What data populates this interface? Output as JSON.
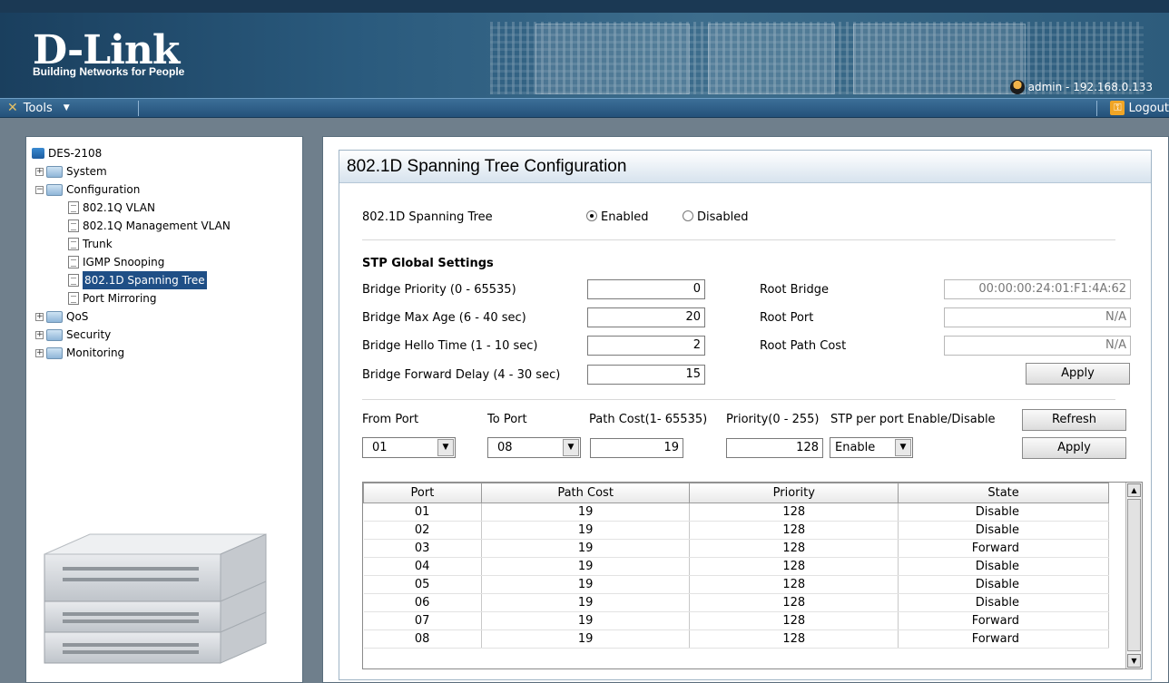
{
  "header": {
    "brand": "D-Link",
    "tagline": "Building Networks for People",
    "user": "admin - 192.168.0.133"
  },
  "toolbar": {
    "tools_label": "Tools",
    "logout_label": "Logout"
  },
  "tree": {
    "root": "DES-2108",
    "items": [
      {
        "label": "System",
        "type": "folder"
      },
      {
        "label": "Configuration",
        "type": "folder"
      },
      {
        "label": "802.1Q VLAN",
        "type": "doc"
      },
      {
        "label": "802.1Q Management VLAN",
        "type": "doc"
      },
      {
        "label": "Trunk",
        "type": "doc"
      },
      {
        "label": "IGMP Snooping",
        "type": "doc"
      },
      {
        "label": "802.1D Spanning Tree",
        "type": "doc"
      },
      {
        "label": "Port Mirroring",
        "type": "doc"
      },
      {
        "label": "QoS",
        "type": "folder"
      },
      {
        "label": "Security",
        "type": "folder"
      },
      {
        "label": "Monitoring",
        "type": "folder"
      }
    ]
  },
  "page": {
    "title": "802.1D Spanning Tree Configuration",
    "stp_label": "802.1D Spanning Tree",
    "enabled_label": "Enabled",
    "disabled_label": "Disabled",
    "stp_state": "Enabled",
    "global_heading": "STP Global Settings",
    "bridge_priority_label": "Bridge Priority (0 - 65535)",
    "bridge_priority": "0",
    "max_age_label": "Bridge Max Age (6 - 40 sec)",
    "max_age": "20",
    "hello_time_label": "Bridge Hello Time (1 - 10 sec)",
    "hello_time": "2",
    "forward_delay_label": "Bridge Forward Delay (4 - 30 sec)",
    "forward_delay": "15",
    "root_bridge_label": "Root Bridge",
    "root_bridge": "00:00:00:24:01:F1:4A:62",
    "root_port_label": "Root Port",
    "root_port": "N/A",
    "root_path_cost_label": "Root Path Cost",
    "root_path_cost": "N/A",
    "apply_label": "Apply",
    "from_port_label": "From Port",
    "to_port_label": "To Port",
    "path_cost_label": "Path Cost(1- 65535)",
    "priority_label": "Priority(0 - 255)",
    "per_port_label": "STP per port Enable/Disable",
    "refresh_label": "Refresh",
    "from_port": "01",
    "to_port": "08",
    "path_cost": "19",
    "priority": "128",
    "per_port_state": "Enable"
  },
  "ports_table": {
    "columns": [
      "Port",
      "Path Cost",
      "Priority",
      "State"
    ],
    "rows": [
      [
        "01",
        "19",
        "128",
        "Disable"
      ],
      [
        "02",
        "19",
        "128",
        "Disable"
      ],
      [
        "03",
        "19",
        "128",
        "Forward"
      ],
      [
        "04",
        "19",
        "128",
        "Disable"
      ],
      [
        "05",
        "19",
        "128",
        "Disable"
      ],
      [
        "06",
        "19",
        "128",
        "Disable"
      ],
      [
        "07",
        "19",
        "128",
        "Forward"
      ],
      [
        "08",
        "19",
        "128",
        "Forward"
      ]
    ]
  }
}
